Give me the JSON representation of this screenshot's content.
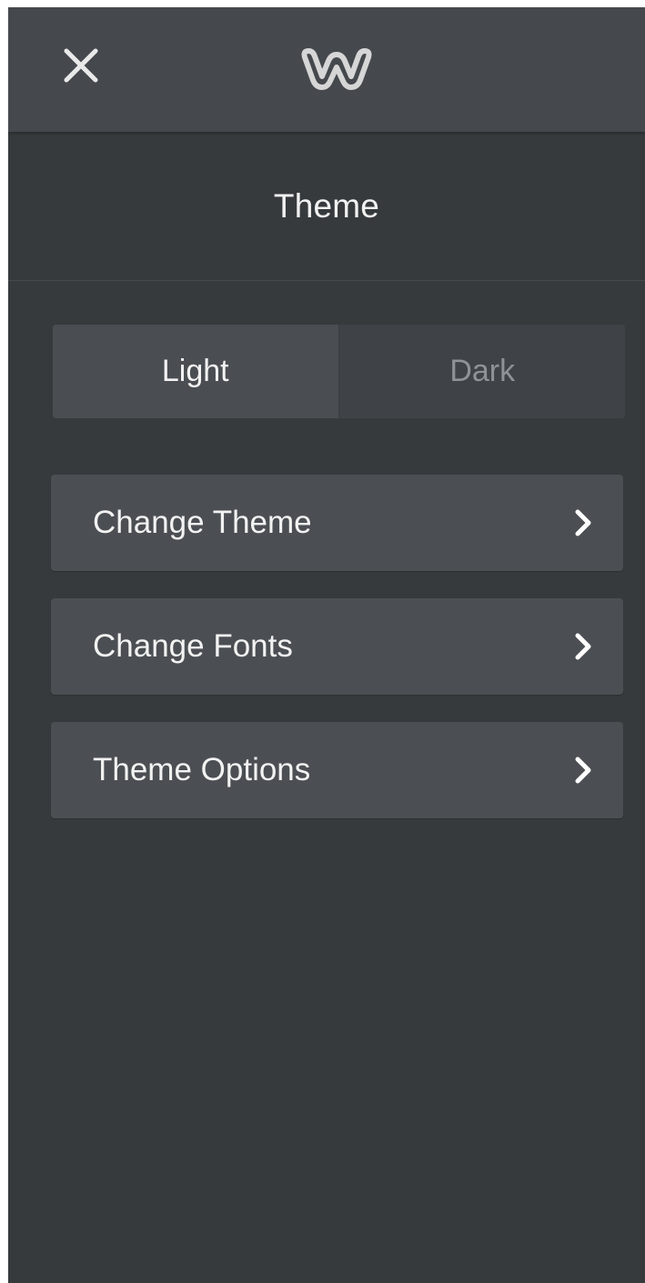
{
  "header": {
    "close_icon": "close-icon",
    "logo_icon": "weebly-logo-icon"
  },
  "panel": {
    "title": "Theme"
  },
  "style_toggle": {
    "options": [
      {
        "label": "Light",
        "selected": true
      },
      {
        "label": "Dark",
        "selected": false
      }
    ]
  },
  "menu": {
    "items": [
      {
        "label": "Change Theme",
        "icon": "chevron-right-icon"
      },
      {
        "label": "Change Fonts",
        "icon": "chevron-right-icon"
      },
      {
        "label": "Theme Options",
        "icon": "chevron-right-icon"
      }
    ]
  },
  "colors": {
    "panel_background": "#363a3d",
    "topbar_background": "#45494d",
    "item_background": "#4b4f53",
    "text_primary": "#f2f2f2",
    "text_muted": "#8f9398"
  }
}
